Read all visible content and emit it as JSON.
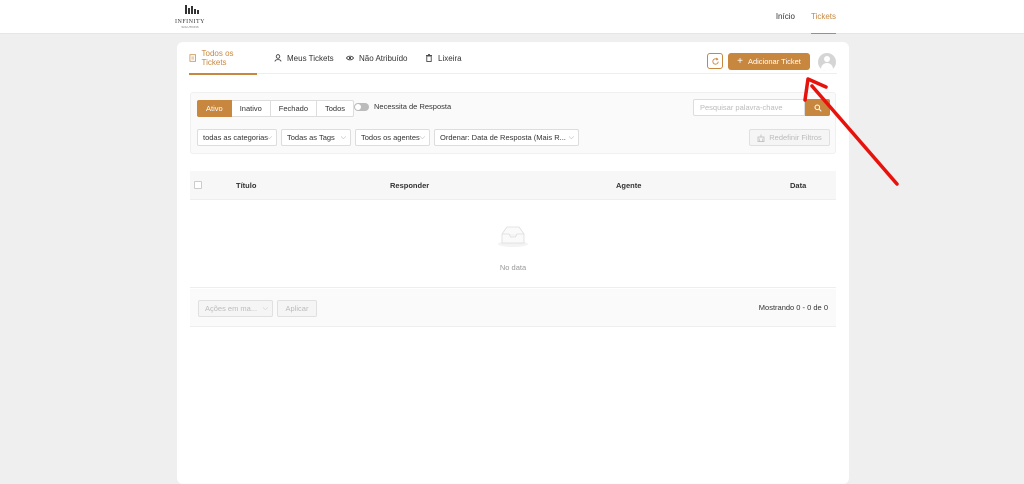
{
  "logo": {
    "text": "INFINITY",
    "sub": "SOLUTIONS"
  },
  "topnav": {
    "items": [
      "Início",
      "Tickets"
    ],
    "active": "Tickets"
  },
  "tabs": [
    {
      "label": "Todos os Tickets",
      "icon": "ticket-icon",
      "active": true
    },
    {
      "label": "Meus Tickets",
      "icon": "user-icon",
      "active": false
    },
    {
      "label": "Não Atribuído",
      "icon": "eye-icon",
      "active": false
    },
    {
      "label": "Lixeira",
      "icon": "trash-icon",
      "active": false
    }
  ],
  "actions": {
    "refresh_icon": "refresh-icon",
    "add_ticket": "Adicionar Ticket"
  },
  "filters": {
    "status": [
      "Ativo",
      "Inativo",
      "Fechado",
      "Todos"
    ],
    "status_active": "Ativo",
    "needs_response": "Necessita de Resposta",
    "search_placeholder": "Pesquisar palavra-chave",
    "category": "todas as categorias",
    "tags": "Todas as Tags",
    "agents": "Todos os agentes",
    "order": "Ordenar: Data de Resposta (Mais R...",
    "reset": "Redefinir Filtros"
  },
  "table": {
    "columns": [
      "Título",
      "Responder",
      "Agente",
      "Data"
    ],
    "empty_text": "No data"
  },
  "footer": {
    "bulk_placeholder": "Ações em ma...",
    "apply": "Aplicar",
    "count": "Mostrando 0 - 0 de 0"
  },
  "colors": {
    "accent": "#c8873e",
    "annotation_arrow": "#e8120c"
  }
}
